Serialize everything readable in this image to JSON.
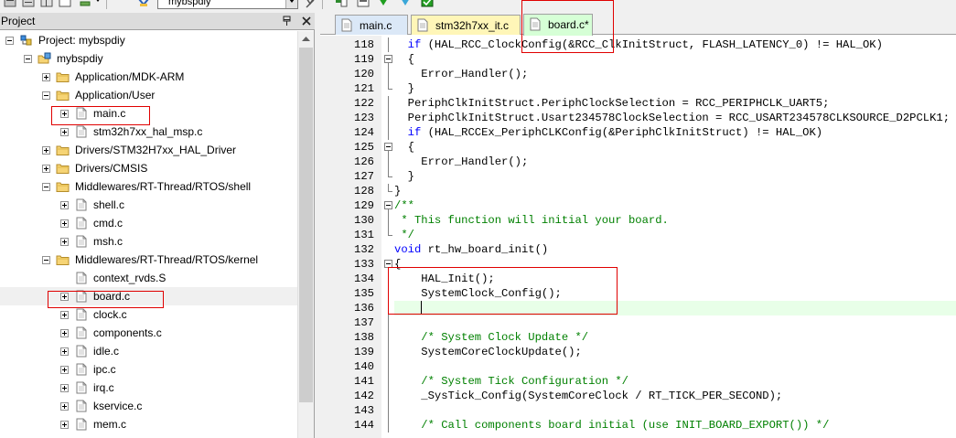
{
  "toolbar": {
    "target_combo": "mybspdiy"
  },
  "project_panel": {
    "title": "Project",
    "tree": [
      {
        "label": "Project: mybspdiy",
        "indent": 0,
        "icon": "project",
        "expander": "minus"
      },
      {
        "label": "mybspdiy",
        "indent": 1,
        "icon": "target",
        "expander": "minus"
      },
      {
        "label": "Application/MDK-ARM",
        "indent": 2,
        "icon": "folder",
        "expander": "plus"
      },
      {
        "label": "Application/User",
        "indent": 2,
        "icon": "folder",
        "expander": "minus"
      },
      {
        "label": "main.c",
        "indent": 3,
        "icon": "file",
        "expander": "plus"
      },
      {
        "label": "stm32h7xx_hal_msp.c",
        "indent": 3,
        "icon": "file",
        "expander": "plus"
      },
      {
        "label": "Drivers/STM32H7xx_HAL_Driver",
        "indent": 2,
        "icon": "folder",
        "expander": "plus"
      },
      {
        "label": "Drivers/CMSIS",
        "indent": 2,
        "icon": "folder",
        "expander": "plus"
      },
      {
        "label": "Middlewares/RT-Thread/RTOS/shell",
        "indent": 2,
        "icon": "folder",
        "expander": "minus"
      },
      {
        "label": "shell.c",
        "indent": 3,
        "icon": "file",
        "expander": "plus"
      },
      {
        "label": "cmd.c",
        "indent": 3,
        "icon": "file",
        "expander": "plus"
      },
      {
        "label": "msh.c",
        "indent": 3,
        "icon": "file",
        "expander": "plus"
      },
      {
        "label": "Middlewares/RT-Thread/RTOS/kernel",
        "indent": 2,
        "icon": "folder",
        "expander": "minus"
      },
      {
        "label": "context_rvds.S",
        "indent": 3,
        "icon": "file",
        "expander": "none"
      },
      {
        "label": "board.c",
        "indent": 3,
        "icon": "file",
        "expander": "plus",
        "selected": true
      },
      {
        "label": "clock.c",
        "indent": 3,
        "icon": "file",
        "expander": "plus"
      },
      {
        "label": "components.c",
        "indent": 3,
        "icon": "file",
        "expander": "plus"
      },
      {
        "label": "idle.c",
        "indent": 3,
        "icon": "file",
        "expander": "plus"
      },
      {
        "label": "ipc.c",
        "indent": 3,
        "icon": "file",
        "expander": "plus"
      },
      {
        "label": "irq.c",
        "indent": 3,
        "icon": "file",
        "expander": "plus"
      },
      {
        "label": "kservice.c",
        "indent": 3,
        "icon": "file",
        "expander": "plus"
      },
      {
        "label": "mem.c",
        "indent": 3,
        "icon": "file",
        "expander": "plus"
      }
    ]
  },
  "editor": {
    "tabs": [
      {
        "label": "main.c",
        "bg": "#dbe8f7",
        "active": false
      },
      {
        "label": "stm32h7xx_it.c",
        "bg": "#fff6b8",
        "active": false
      },
      {
        "label": "board.c*",
        "bg": "#d6ffd6",
        "active": true
      }
    ],
    "lines": [
      {
        "n": "118",
        "fold": "line",
        "segs": [
          {
            "t": "  "
          },
          {
            "t": "if",
            "c": "kw"
          },
          {
            "t": " (HAL_RCC_ClockConfig(&RCC_ClkInitStruct, FLASH_LATENCY_0) != HAL_OK)"
          }
        ]
      },
      {
        "n": "119",
        "fold": "box",
        "segs": [
          {
            "t": "  {"
          }
        ]
      },
      {
        "n": "120",
        "fold": "line",
        "segs": [
          {
            "t": "    Error_Handler();"
          }
        ]
      },
      {
        "n": "121",
        "fold": "end",
        "segs": [
          {
            "t": "  }"
          }
        ]
      },
      {
        "n": "122",
        "fold": "line",
        "segs": [
          {
            "t": "  PeriphClkInitStruct.PeriphClockSelection = RCC_PERIPHCLK_UART5;"
          }
        ]
      },
      {
        "n": "123",
        "fold": "line",
        "segs": [
          {
            "t": "  PeriphClkInitStruct.Usart234578ClockSelection = RCC_USART234578CLKSOURCE_D2PCLK1;"
          }
        ]
      },
      {
        "n": "124",
        "fold": "line",
        "segs": [
          {
            "t": "  "
          },
          {
            "t": "if",
            "c": "kw"
          },
          {
            "t": " (HAL_RCCEx_PeriphCLKConfig(&PeriphClkInitStruct) != HAL_OK)"
          }
        ]
      },
      {
        "n": "125",
        "fold": "box",
        "segs": [
          {
            "t": "  {"
          }
        ]
      },
      {
        "n": "126",
        "fold": "line",
        "segs": [
          {
            "t": "    Error_Handler();"
          }
        ]
      },
      {
        "n": "127",
        "fold": "end",
        "segs": [
          {
            "t": "  }"
          }
        ]
      },
      {
        "n": "128",
        "fold": "end",
        "segs": [
          {
            "t": "}"
          }
        ]
      },
      {
        "n": "129",
        "fold": "box",
        "segs": [
          {
            "t": "/**",
            "c": "cm"
          }
        ]
      },
      {
        "n": "130",
        "fold": "line",
        "segs": [
          {
            "t": " * This function will initial your board.",
            "c": "cm"
          }
        ]
      },
      {
        "n": "131",
        "fold": "end",
        "segs": [
          {
            "t": " */",
            "c": "cm"
          }
        ]
      },
      {
        "n": "132",
        "fold": "none",
        "segs": [
          {
            "t": "void",
            "c": "kw"
          },
          {
            "t": " rt_hw_board_init()"
          }
        ]
      },
      {
        "n": "133",
        "fold": "box",
        "segs": [
          {
            "t": "{"
          }
        ]
      },
      {
        "n": "134",
        "fold": "line",
        "segs": [
          {
            "t": "    HAL_Init();"
          }
        ]
      },
      {
        "n": "135",
        "fold": "line",
        "segs": [
          {
            "t": "    SystemClock_Config();"
          }
        ]
      },
      {
        "n": "136",
        "fold": "line",
        "current": true,
        "segs": [
          {
            "t": "    "
          }
        ]
      },
      {
        "n": "137",
        "fold": "line",
        "segs": [
          {
            "t": ""
          }
        ]
      },
      {
        "n": "138",
        "fold": "line",
        "segs": [
          {
            "t": "    "
          },
          {
            "t": "/* System Clock Update */",
            "c": "cm"
          }
        ]
      },
      {
        "n": "139",
        "fold": "line",
        "segs": [
          {
            "t": "    SystemCoreClockUpdate();"
          }
        ]
      },
      {
        "n": "140",
        "fold": "line",
        "segs": [
          {
            "t": ""
          }
        ]
      },
      {
        "n": "141",
        "fold": "line",
        "segs": [
          {
            "t": "    "
          },
          {
            "t": "/* System Tick Configuration */",
            "c": "cm"
          }
        ]
      },
      {
        "n": "142",
        "fold": "line",
        "segs": [
          {
            "t": "    _SysTick_Config(SystemCoreClock / RT_TICK_PER_SECOND);"
          }
        ]
      },
      {
        "n": "143",
        "fold": "line",
        "segs": [
          {
            "t": ""
          }
        ]
      },
      {
        "n": "144",
        "fold": "line",
        "segs": [
          {
            "t": "    "
          },
          {
            "t": "/* Call components board initial (use INIT_BOARD_EXPORT()) */",
            "c": "cm"
          }
        ]
      }
    ]
  },
  "colors": {
    "annotation": "#e00000",
    "keyword": "#0000ff",
    "comment": "#008000"
  }
}
